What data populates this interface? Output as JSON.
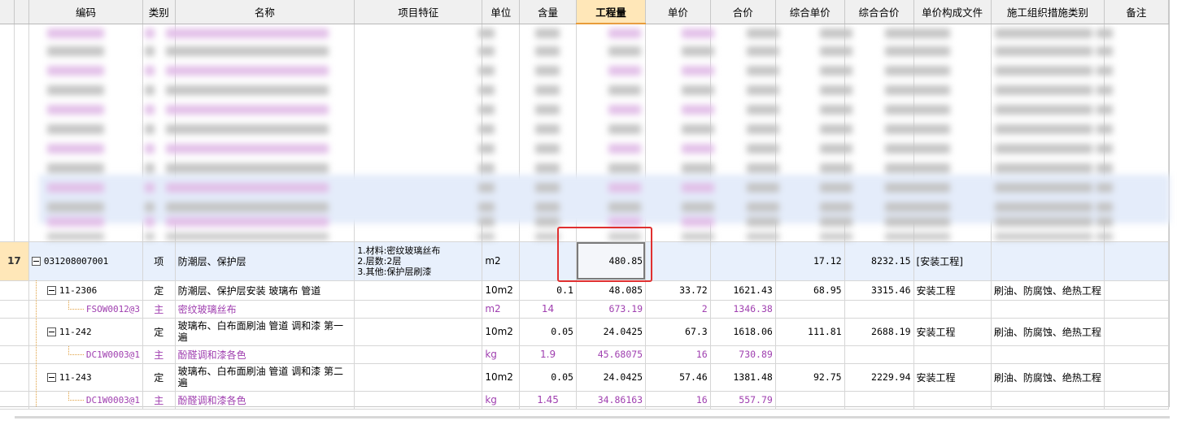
{
  "headers": [
    "编码",
    "类别",
    "名称",
    "项目特征",
    "单位",
    "含量",
    "工程量",
    "单价",
    "合价",
    "综合单价",
    "综合合价",
    "单价构成文件",
    "施工组织措施类别",
    "备注"
  ],
  "selected_header_index": 6,
  "main_row": {
    "row_number": "17",
    "code": "031208007001",
    "type": "项",
    "name": "防潮层、保护层",
    "features": [
      "1.材料:密纹玻璃丝布",
      "2.层数:2层",
      "3.其他:保护层刷漆"
    ],
    "unit": "m2",
    "content": "",
    "quantity": "480.85",
    "unit_price": "",
    "total_price": "",
    "composite_unit_price": "17.12",
    "composite_total": "8232.15",
    "price_file": "[安装工程]",
    "measure_category": "",
    "remark": ""
  },
  "sub_rows": [
    {
      "kind": "ding",
      "code": "11-2306",
      "type": "定",
      "name": "防潮层、保护层安装 玻璃布 管道",
      "unit": "10m2",
      "content": "0.1",
      "quantity": "48.085",
      "unit_price": "33.72",
      "total_price": "1621.43",
      "composite_unit_price": "68.95",
      "composite_total": "3315.46",
      "price_file": "安装工程",
      "measure_category": "刷油、防腐蚀、绝热工程"
    },
    {
      "kind": "zhu",
      "code": "FSOW0012@3",
      "type": "主",
      "name": "密纹玻璃丝布",
      "unit": "m2",
      "content": "14",
      "quantity": "673.19",
      "unit_price": "2",
      "total_price": "1346.38",
      "composite_unit_price": "",
      "composite_total": "",
      "price_file": "",
      "measure_category": ""
    },
    {
      "kind": "ding",
      "code": "11-242",
      "type": "定",
      "name": "玻璃布、白布面刷油 管道 调和漆 第一遍",
      "unit": "10m2",
      "content": "0.05",
      "quantity": "24.0425",
      "unit_price": "67.3",
      "total_price": "1618.06",
      "composite_unit_price": "111.81",
      "composite_total": "2688.19",
      "price_file": "安装工程",
      "measure_category": "刷油、防腐蚀、绝热工程"
    },
    {
      "kind": "zhu",
      "code": "DC1W0003@1",
      "type": "主",
      "name": "酚醛调和漆各色",
      "unit": "kg",
      "content": "1.9",
      "quantity": "45.68075",
      "unit_price": "16",
      "total_price": "730.89",
      "composite_unit_price": "",
      "composite_total": "",
      "price_file": "",
      "measure_category": ""
    },
    {
      "kind": "ding",
      "code": "11-243",
      "type": "定",
      "name": "玻璃布、白布面刷油 管道 调和漆 第二遍",
      "unit": "10m2",
      "content": "0.05",
      "quantity": "24.0425",
      "unit_price": "57.46",
      "total_price": "1381.48",
      "composite_unit_price": "92.75",
      "composite_total": "2229.94",
      "price_file": "安装工程",
      "measure_category": "刷油、防腐蚀、绝热工程"
    },
    {
      "kind": "zhu",
      "code": "DC1W0003@1",
      "type": "主",
      "name": "酚醛调和漆各色",
      "unit": "kg",
      "content": "1.45",
      "quantity": "34.86163",
      "unit_price": "16",
      "total_price": "557.79",
      "composite_unit_price": "",
      "composite_total": "",
      "price_file": "",
      "measure_category": ""
    }
  ],
  "colors": {
    "selected_row_bg": "#e8f0fc",
    "selected_header_bg": "#ffe7b8",
    "main_material_text": "#a040b0",
    "highlight_box": "#e03030"
  }
}
